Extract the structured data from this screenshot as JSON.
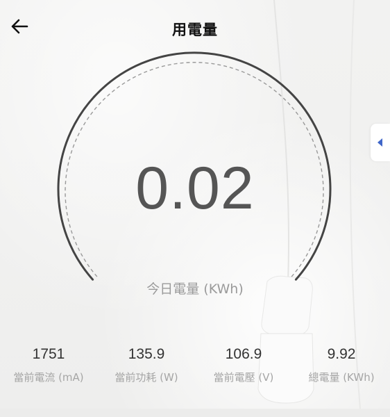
{
  "header": {
    "title": "用電量",
    "back_icon": "arrow-left-icon"
  },
  "gauge": {
    "value": "0.02",
    "caption": "今日電量 (KWh)"
  },
  "side_tab": {
    "icon": "caret-left-icon",
    "accent": "#3f66c9"
  },
  "stats": [
    {
      "value": "1751",
      "label": "當前電流 (mA)"
    },
    {
      "value": "135.9",
      "label": "當前功耗 (W)"
    },
    {
      "value": "106.9",
      "label": "當前電壓 (V)"
    },
    {
      "value": "9.92",
      "label": "總電量 (KWh)"
    }
  ]
}
